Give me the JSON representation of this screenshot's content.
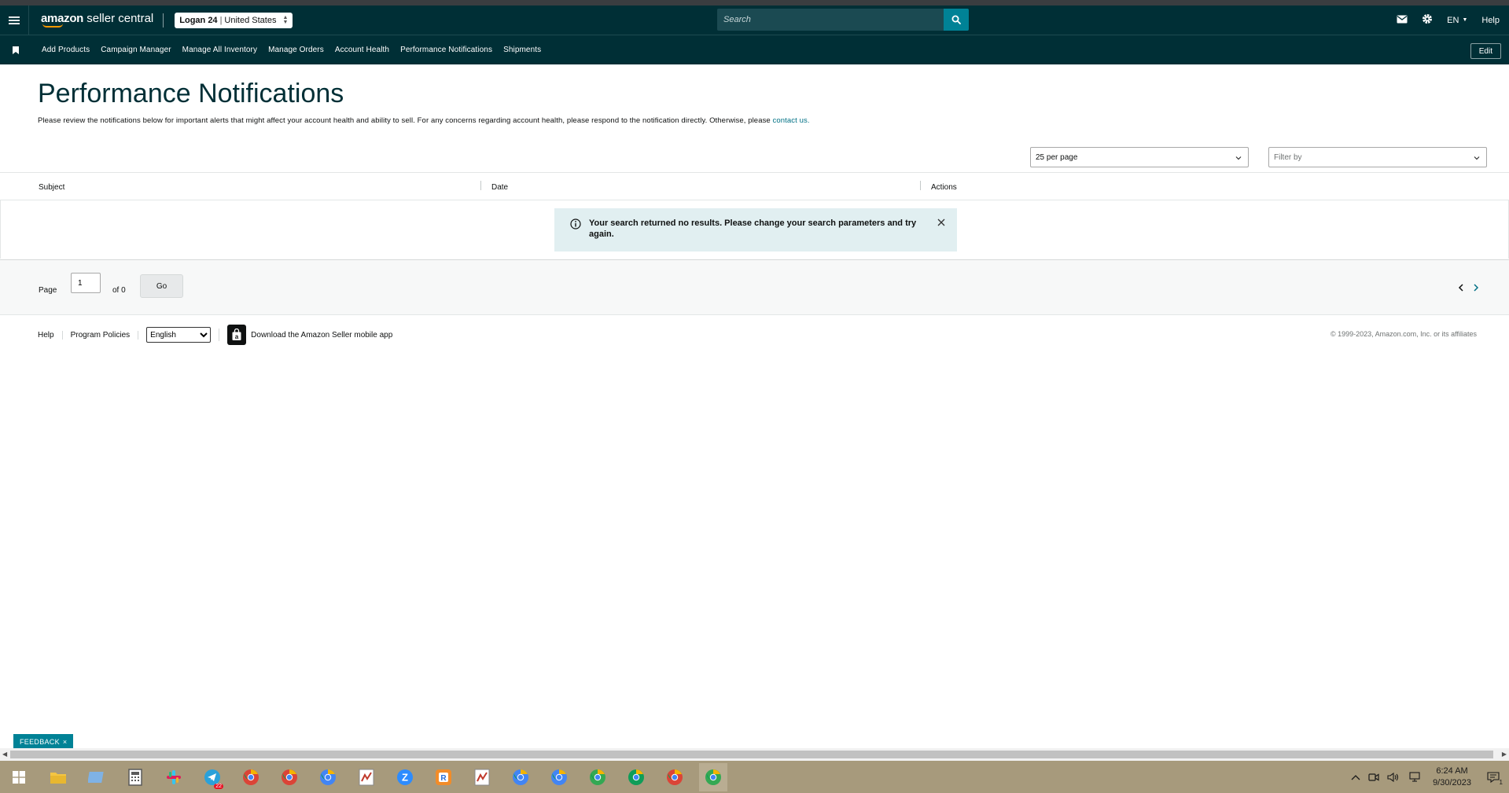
{
  "header": {
    "logo_brand": "amazon",
    "logo_product": " seller central",
    "account_name": "Logan 24",
    "account_marketplace": "United States",
    "search_placeholder": "Search",
    "language": "EN",
    "help": "Help"
  },
  "nav": {
    "items": [
      "Add Products",
      "Campaign Manager",
      "Manage All Inventory",
      "Manage Orders",
      "Account Health",
      "Performance Notifications",
      "Shipments"
    ],
    "edit_label": "Edit"
  },
  "page": {
    "title": "Performance Notifications",
    "description": "Please review the notifications below for important alerts that might affect your account health and ability to sell. For any concerns regarding account health, please respond to the notification directly. Otherwise, please ",
    "contact_link": "contact us."
  },
  "filters": {
    "per_page": "25 per page",
    "filter_by": "Filter by"
  },
  "table": {
    "columns": [
      "Subject",
      "Date",
      "Actions"
    ],
    "empty_message": "Your search returned no results. Please change your search parameters and try again."
  },
  "pagination": {
    "page_label": "Page",
    "current_page": "1",
    "of_label": "of 0",
    "go_label": "Go"
  },
  "footer": {
    "help": "Help",
    "program_policies": "Program Policies",
    "language_selected": "English",
    "app_link": "Download the Amazon Seller mobile app",
    "copyright": "© 1999-2023, Amazon.com, Inc. or its affiliates"
  },
  "feedback": {
    "label": "FEEDBACK"
  },
  "taskbar": {
    "apps": [
      {
        "icon": "file-explorer-icon",
        "color": "#f4c542"
      },
      {
        "icon": "notepad-icon",
        "color": "#7fb2e5"
      },
      {
        "icon": "calculator-icon",
        "color": "#5a5a5a"
      },
      {
        "icon": "slack-icon",
        "color": "#e01e5a"
      },
      {
        "icon": "telegram-icon",
        "color": "#2aa1da",
        "badge": "22"
      },
      {
        "icon": "chrome-icon",
        "color": "#db4437"
      },
      {
        "icon": "chrome-profile-icon",
        "color": "#db4437"
      },
      {
        "icon": "chrome-profile-icon",
        "color": "#4285f4"
      },
      {
        "icon": "spreadsheet-icon",
        "color": "#c0392b"
      },
      {
        "icon": "zoom-icon",
        "color": "#2d8cff"
      },
      {
        "icon": "r-app-icon",
        "color": "#f28c28"
      },
      {
        "icon": "spreadsheet-icon",
        "color": "#c0392b"
      },
      {
        "icon": "chrome-profile-icon",
        "color": "#4285f4"
      },
      {
        "icon": "chrome-profile-icon",
        "color": "#4285f4"
      },
      {
        "icon": "chrome-profile-icon",
        "color": "#34a853"
      },
      {
        "icon": "chrome-profile-icon",
        "color": "#0f9d58"
      },
      {
        "icon": "chrome-icon",
        "color": "#db4437"
      },
      {
        "icon": "chrome-profile-icon",
        "color": "#34a853"
      }
    ],
    "time": "6:24 AM",
    "date": "9/30/2023",
    "notification_count": "1"
  },
  "colors": {
    "header_bg": "#002f36",
    "accent": "#008296",
    "link": "#007185",
    "alert_bg": "#e1eff1"
  }
}
